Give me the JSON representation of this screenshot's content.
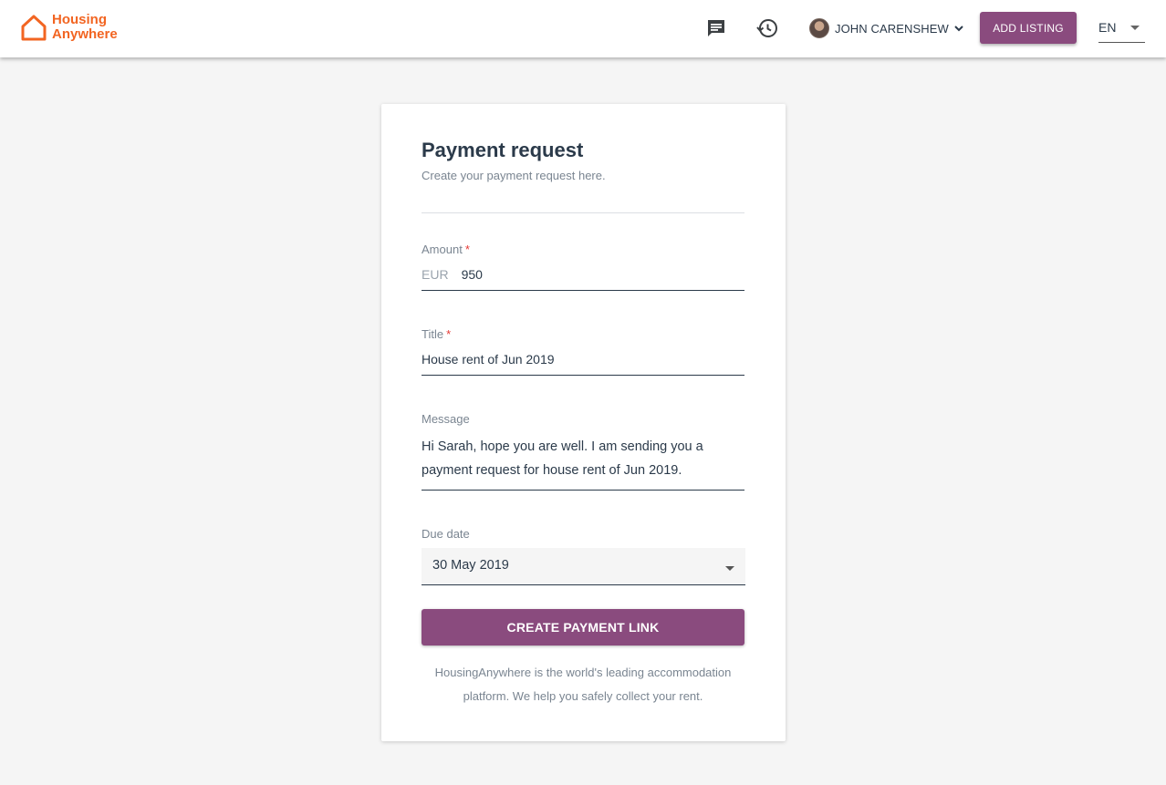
{
  "header": {
    "logo_line1": "Housing",
    "logo_line2": "Anywhere",
    "messages_icon": "chat-message-icon",
    "history_icon": "history-icon",
    "user_name": "JOHN CARENSHEW",
    "add_listing_label": "ADD LISTING",
    "language": "EN"
  },
  "form": {
    "title": "Payment request",
    "subtitle": "Create your payment request here.",
    "amount": {
      "label": "Amount",
      "required_mark": "*",
      "currency": "EUR",
      "value": "950"
    },
    "title_field": {
      "label": "Title",
      "required_mark": "*",
      "value": "House rent of Jun 2019"
    },
    "message": {
      "label": "Message",
      "value": "Hi Sarah, hope you are well. I am sending you a payment request for house rent of Jun 2019."
    },
    "due_date": {
      "label": "Due date",
      "value": "30 May 2019"
    },
    "submit_label": "CREATE PAYMENT LINK",
    "footer_note": "HousingAnywhere is the world's leading accommodation platform. We help you safely collect your rent."
  },
  "colors": {
    "brand_orange": "#f26522",
    "accent_purple": "#8a4b7e",
    "text_dark": "#2b3a4a",
    "text_muted": "#7a8591",
    "required_red": "#e53935"
  }
}
